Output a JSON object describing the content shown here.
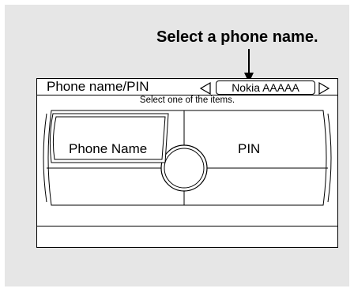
{
  "callout": {
    "text": "Select a phone name."
  },
  "screen": {
    "title": "Phone name/PIN",
    "selector_value": "Nokia AAAAA",
    "instruction": "Select one of the items.",
    "items": [
      {
        "label": "Phone Name",
        "selected": true
      },
      {
        "label": "PIN",
        "selected": false
      }
    ]
  }
}
